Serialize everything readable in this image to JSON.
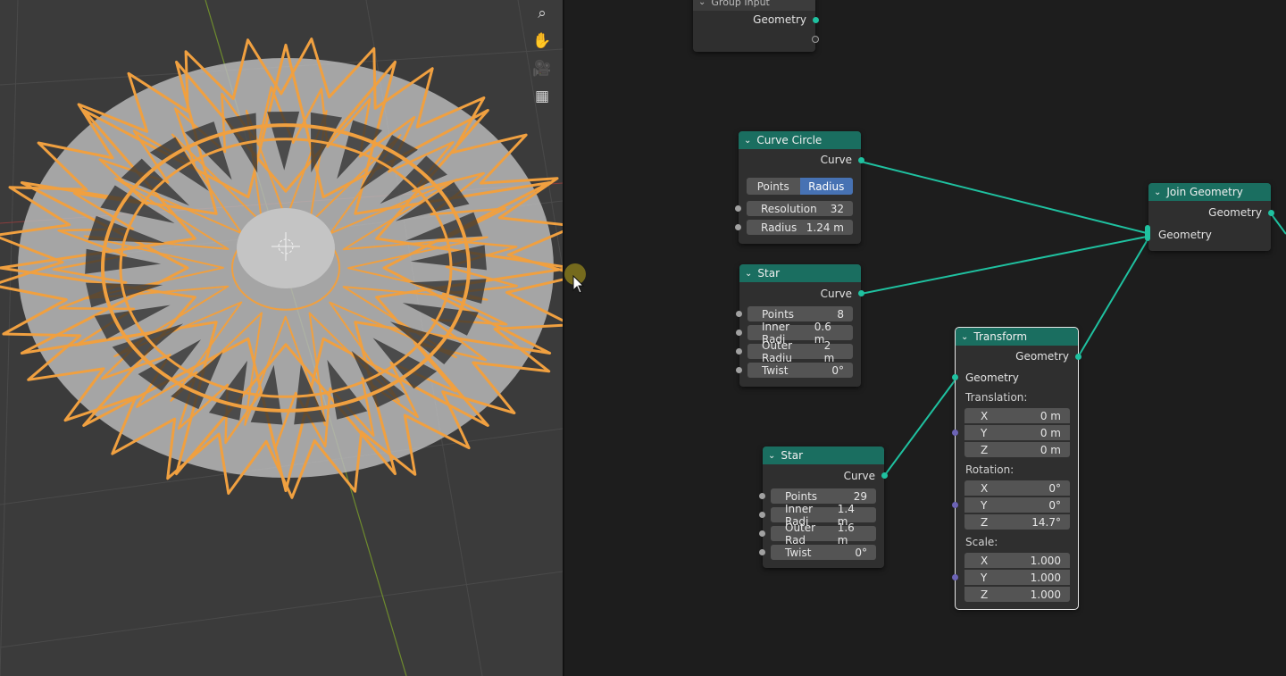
{
  "colors": {
    "geometry_socket": "#1fc1a0",
    "float_socket": "#a1a1a1",
    "vector_socket": "#6c63b5",
    "node_header": "#1a6e60",
    "selection_orange": "#f0a040",
    "active_toggle": "#4772b3"
  },
  "viewport": {
    "tools": [
      {
        "icon": "zoom-icon",
        "glyph": "⌕"
      },
      {
        "icon": "hand-pan-icon",
        "glyph": "✋"
      },
      {
        "icon": "camera-icon",
        "glyph": "🎥"
      },
      {
        "icon": "grid-view-icon",
        "glyph": "▦"
      }
    ]
  },
  "group_input": {
    "title": "Group Input",
    "geometry": "Geometry"
  },
  "curve_circle": {
    "title": "Curve Circle",
    "output": "Curve",
    "mode_points": "Points",
    "mode_radius": "Radius",
    "resolution_label": "Resolution",
    "resolution_value": "32",
    "radius_label": "Radius",
    "radius_value": "1.24 m"
  },
  "star1": {
    "title": "Star",
    "output": "Curve",
    "points_label": "Points",
    "points_value": "8",
    "inner_label": "Inner Radi",
    "inner_value": "0.6 m",
    "outer_label": "Outer Radiu",
    "outer_value": "2 m",
    "twist_label": "Twist",
    "twist_value": "0°"
  },
  "star2": {
    "title": "Star",
    "output": "Curve",
    "points_label": "Points",
    "points_value": "29",
    "inner_label": "Inner Radi",
    "inner_value": "1.4 m",
    "outer_label": "Outer Rad",
    "outer_value": "1.6 m",
    "twist_label": "Twist",
    "twist_value": "0°"
  },
  "transform": {
    "title": "Transform",
    "output": "Geometry",
    "input": "Geometry",
    "translation_label": "Translation:",
    "tx": "0 m",
    "ty": "0 m",
    "tz": "0 m",
    "rotation_label": "Rotation:",
    "rx": "0°",
    "ry": "0°",
    "rz": "14.7°",
    "scale_label": "Scale:",
    "sx": "1.000",
    "sy": "1.000",
    "sz": "1.000",
    "axis_x": "X",
    "axis_y": "Y",
    "axis_z": "Z"
  },
  "join_geometry": {
    "title": "Join Geometry",
    "output": "Geometry",
    "input": "Geometry"
  }
}
